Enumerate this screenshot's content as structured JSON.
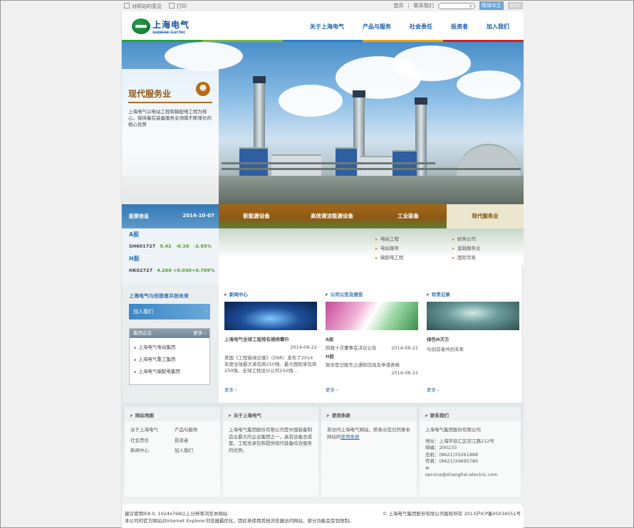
{
  "topbar": {
    "feedback": "对网站的意见",
    "print": "打印",
    "home": "首页",
    "contact": "联系我们",
    "search_icon": "search-icon",
    "lang_cn": "简体中文",
    "lang_en": "ENG"
  },
  "header": {
    "logo_cn": "上海电气",
    "logo_en": "SHANGHAI ELECTRIC",
    "nav": [
      "关于上海电气",
      "产品与服务",
      "社会责任",
      "投资者",
      "加入我们"
    ],
    "colors": [
      "#2a9f3c",
      "#7ab648",
      "#2f7fc4",
      "#e2a31b",
      "#c1272d"
    ]
  },
  "hero": {
    "title": "现代服务业",
    "badge_icon": "people-icon",
    "description": "上海电气以电站工程和输配电工程为核心，保持着在装备服务业领域不断增长的核心优势"
  },
  "stock": {
    "header": "股票信息",
    "date": "2014-10-07",
    "a_label": "A股",
    "a_code": "SH601727",
    "a_price": "5.42",
    "a_change": "-0.16",
    "a_pct": "-2.95%",
    "h_label": "H股",
    "h_code": "HK02727",
    "h_price": "4.260",
    "h_change": "+0.030",
    "h_pct": "+0.709%"
  },
  "segments": [
    "新能源设备",
    "高效清洁能源设备",
    "工业装备",
    "现代服务业"
  ],
  "submenu": {
    "col1": [
      "电站工程",
      "电站服务",
      "输配电工程"
    ],
    "col2": [
      "财务公司",
      "金融服务业",
      "国际贸易"
    ]
  },
  "left": {
    "slogan": "上海电气与创造者共创未来",
    "join": "加入我们",
    "group_header": "集团企业",
    "group_more": "更多",
    "groups": [
      "上海电气电站集团",
      "上海电气重工集团",
      "上海电气输配电集团"
    ]
  },
  "news": {
    "header": "新闻中心",
    "headline": "上海电气全球工程排名继续攀升",
    "date": "2014-09-22",
    "body": "美国《工程新闻记录》（ENR）发布了2014年度全球最大承包商250强、最大国际承包商250强、全球工程设计公司150强...",
    "more": "更多"
  },
  "notices": {
    "header": "公司公告及报告",
    "a_label": "A股",
    "a_item": "四届十次董事会决议公告",
    "a_date": "2014-08-22",
    "h_label": "H股",
    "h_item": "致非登记股东之通知信函及申请表格",
    "h_date": "2014-08-22",
    "more": "更多"
  },
  "records": {
    "header": "珍贵记录",
    "title": "绿色N次方",
    "subtitle": "与创造者共创未来",
    "more": "更多"
  },
  "footer": {
    "sitemap_header": "网站地图",
    "sitemap": [
      "关于上海电气",
      "产品与服务",
      "社会责任",
      "投资者",
      "新闻中心",
      "加入我们"
    ],
    "about_header": "关于上海电气",
    "about_text": "上海电气集团股份有限公司是中国装备制造业最大的企业集团之一，具有设备总成套、工程总承包和提供现代装备综合服务的优势。",
    "terms_header": "使用条款",
    "terms_text": "若访问上海电气网站，即表示您已同意本网站的",
    "terms_link": "使用条款",
    "contact_header": "联系我们",
    "company": "上海电气集团股份有限公司",
    "address": "地址：上海市徐汇区钦江路212号",
    "zip": "邮编：200233",
    "phone": "总机：(8621)33261888",
    "fax": "传真：(8621)34695780",
    "email": "service@shanghai-electric.com"
  },
  "bottom": {
    "line1": "建议使用IE8.0, 1024x768以上分辨率浏览本网站",
    "line2": "本公司的官方网站对Internet Explorer浏览器最优化，因此若使用其他浏览器访问网站，部分功能会受到限制。",
    "copyright": "© 上海电气集团股份有限公司版权所有 2013沪ICP备05034551号"
  }
}
